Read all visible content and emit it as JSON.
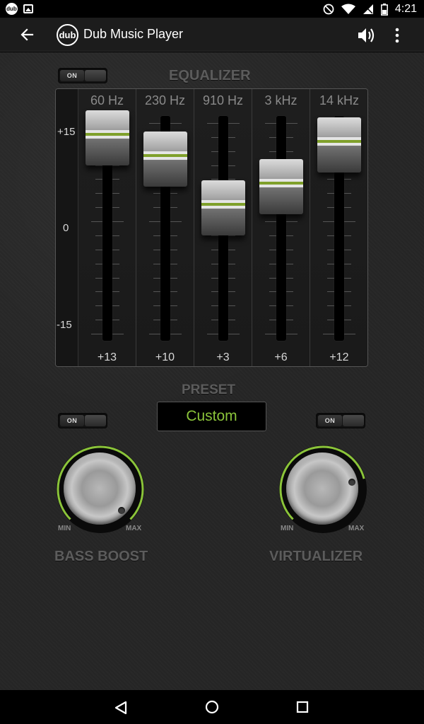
{
  "status_bar": {
    "time": "4:21",
    "left_icons": [
      "dub-notification-icon",
      "image-notification-icon"
    ],
    "right_icons": [
      "do-not-disturb-icon",
      "wifi-icon",
      "no-sim-icon",
      "battery-icon"
    ],
    "dub_mini_label": "dub"
  },
  "app_bar": {
    "logo_text": "dub",
    "title": "Dub Music Player"
  },
  "equalizer": {
    "title": "EQUALIZER",
    "toggle_label": "ON",
    "scale": [
      "+15",
      "0",
      "-15"
    ],
    "bands": [
      {
        "freq": "60 Hz",
        "value_label": "+13",
        "value": 13
      },
      {
        "freq": "230 Hz",
        "value_label": "+10",
        "value": 10
      },
      {
        "freq": "910 Hz",
        "value_label": "+3",
        "value": 3
      },
      {
        "freq": "3 kHz",
        "value_label": "+6",
        "value": 6
      },
      {
        "freq": "14 kHz",
        "value_label": "+12",
        "value": 12
      }
    ],
    "range": [
      -15,
      15
    ]
  },
  "preset": {
    "title": "PRESET",
    "value": "Custom"
  },
  "bass_boost": {
    "title": "BASS BOOST",
    "toggle_label": "ON",
    "min_label": "MIN",
    "max_label": "MAX",
    "level": 1.0
  },
  "virtualizer": {
    "title": "VIRTUALIZER",
    "toggle_label": "ON",
    "min_label": "MIN",
    "max_label": "MAX",
    "level": 0.78
  },
  "colors": {
    "accent": "#8bc43a",
    "background": "#262626",
    "title_muted": "#5c5c5c"
  }
}
